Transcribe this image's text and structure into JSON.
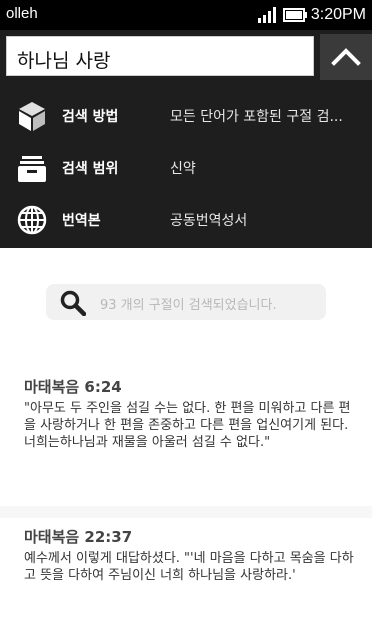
{
  "status_bar": {
    "carrier": "olleh",
    "time": "3:20PM"
  },
  "search": {
    "query": "하나님 사랑"
  },
  "options": [
    {
      "label": "검색 방법",
      "value": "모든 단어가 포함된 구절 검...",
      "icon": "cube-icon"
    },
    {
      "label": "검색 범위",
      "value": "신약",
      "icon": "drawer-icon"
    },
    {
      "label": "번역본",
      "value": "공동번역성서",
      "icon": "globe-icon"
    }
  ],
  "results": {
    "count_text": "93 개의 구절이 검색되었습니다.",
    "verses": [
      {
        "reference": "마태복음 6:24",
        "text": "\"아무도 두 주인을 섬길 수는 없다. 한 편을 미워하고 다른 편을 사랑하거나 한 편을 존중하고 다른 편을 업신여기게 된다. 너희는하나님과 재물을 아울러 섬길 수 없다.\""
      },
      {
        "reference": "마태복음 22:37",
        "text": "예수께서 이렇게 대답하셨다. \"'네 마음을 다하고 목숨을 다하고 뜻을 다하여 주님이신 너희 하나님을 사랑하라.'"
      }
    ]
  },
  "colors": {
    "panel_bg": "#1e1e1e",
    "status_bg": "#000000",
    "collapse_button_bg": "#3a3a3a"
  }
}
